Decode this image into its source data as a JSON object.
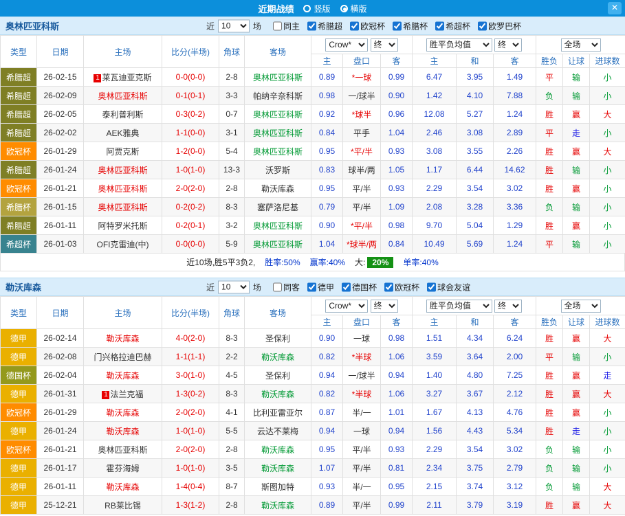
{
  "topbar": {
    "title": "近期战绩",
    "radio_vertical": "竖版",
    "radio_horizontal": "横版",
    "close": "✕"
  },
  "sections": [
    {
      "team": "奥林匹亚科斯",
      "recent_label": "近",
      "recent_count": "10",
      "games_label": "场",
      "checkboxes": [
        {
          "label": "同主",
          "checked": false
        },
        {
          "label": "希腊超",
          "checked": true
        },
        {
          "label": "欧冠杯",
          "checked": true
        },
        {
          "label": "希腊杯",
          "checked": true
        },
        {
          "label": "希超杯",
          "checked": true
        },
        {
          "label": "欧罗巴杯",
          "checked": true
        }
      ],
      "dropdowns": {
        "odds_company": "Crow*",
        "odds_time": "终",
        "europe": "胜平负均值",
        "europe_time": "终",
        "scope": "全场"
      },
      "columns": [
        "类型",
        "日期",
        "主场",
        "比分(半场)",
        "角球",
        "客场",
        "主",
        "盘口",
        "客",
        "主",
        "和",
        "客",
        "胜负",
        "让球",
        "进球数"
      ],
      "rows": [
        {
          "type": "希腊超",
          "type_color": "#7f7f25",
          "date": "26-02-15",
          "home": "莱瓦迪亚克斯",
          "home_badge": "1",
          "home_color": "",
          "score": "0-0(0-0)",
          "corner": "2-8",
          "away": "奥林匹亚科斯",
          "away_color": "green",
          "ah_home": "0.89",
          "handicap": "*一球",
          "ah_away": "0.99",
          "euro_home": "6.47",
          "euro_draw": "3.95",
          "euro_away": "1.49",
          "result": "平",
          "handicap_result": "输",
          "goals": "小"
        },
        {
          "type": "希腊超",
          "type_color": "#7f7f25",
          "date": "26-02-09",
          "home": "奥林匹亚科斯",
          "home_color": "red",
          "score": "0-1(0-1)",
          "corner": "3-3",
          "away": "帕纳辛奈科斯",
          "away_color": "",
          "ah_home": "0.98",
          "handicap": "一/球半",
          "ah_away": "0.90",
          "euro_home": "1.42",
          "euro_draw": "4.10",
          "euro_away": "7.88",
          "result": "负",
          "handicap_result": "输",
          "goals": "小"
        },
        {
          "type": "希腊超",
          "type_color": "#7f7f25",
          "date": "26-02-05",
          "home": "泰利普利斯",
          "home_color": "",
          "score": "0-3(0-2)",
          "corner": "0-7",
          "away": "奥林匹亚科斯",
          "away_color": "green",
          "ah_home": "0.92",
          "handicap": "*球半",
          "ah_away": "0.96",
          "euro_home": "12.08",
          "euro_draw": "5.27",
          "euro_away": "1.24",
          "result": "胜",
          "handicap_result": "赢",
          "goals": "大"
        },
        {
          "type": "希腊超",
          "type_color": "#7f7f25",
          "date": "26-02-02",
          "home": "AEK雅典",
          "home_color": "",
          "score": "1-1(0-0)",
          "corner": "3-1",
          "away": "奥林匹亚科斯",
          "away_color": "green",
          "ah_home": "0.84",
          "handicap": "平手",
          "ah_away": "1.04",
          "euro_home": "2.46",
          "euro_draw": "3.08",
          "euro_away": "2.89",
          "result": "平",
          "handicap_result": "走",
          "goals": "小"
        },
        {
          "type": "欧冠杯",
          "type_color": "#ff8c00",
          "date": "26-01-29",
          "home": "阿贾克斯",
          "home_color": "",
          "score": "1-2(0-0)",
          "corner": "5-4",
          "away": "奥林匹亚科斯",
          "away_color": "green",
          "ah_home": "0.95",
          "handicap": "*平/半",
          "ah_away": "0.93",
          "euro_home": "3.08",
          "euro_draw": "3.55",
          "euro_away": "2.26",
          "result": "胜",
          "handicap_result": "赢",
          "goals": "大"
        },
        {
          "type": "希腊超",
          "type_color": "#7f7f25",
          "date": "26-01-24",
          "home": "奥林匹亚科斯",
          "home_color": "red",
          "score": "1-0(1-0)",
          "corner": "13-3",
          "away": "沃罗斯",
          "away_color": "",
          "ah_home": "0.83",
          "handicap": "球半/两",
          "ah_away": "1.05",
          "euro_home": "1.17",
          "euro_draw": "6.44",
          "euro_away": "14.62",
          "result": "胜",
          "handicap_result": "输",
          "goals": "小"
        },
        {
          "type": "欧冠杯",
          "type_color": "#ff8c00",
          "date": "26-01-21",
          "home": "奥林匹亚科斯",
          "home_color": "red",
          "score": "2-0(2-0)",
          "corner": "2-8",
          "away": "勒沃库森",
          "away_color": "",
          "ah_home": "0.95",
          "handicap": "平/半",
          "ah_away": "0.93",
          "euro_home": "2.29",
          "euro_draw": "3.54",
          "euro_away": "3.02",
          "result": "胜",
          "handicap_result": "赢",
          "goals": "小"
        },
        {
          "type": "希腊杯",
          "type_color": "#b3a33f",
          "date": "26-01-15",
          "home": "奥林匹亚科斯",
          "home_color": "red",
          "score": "0-2(0-2)",
          "corner": "8-3",
          "away": "塞萨洛尼基",
          "away_color": "",
          "ah_home": "0.79",
          "handicap": "平/半",
          "ah_away": "1.09",
          "euro_home": "2.08",
          "euro_draw": "3.28",
          "euro_away": "3.36",
          "result": "负",
          "handicap_result": "输",
          "goals": "小"
        },
        {
          "type": "希腊超",
          "type_color": "#7f7f25",
          "date": "26-01-11",
          "home": "阿特罗米托斯",
          "home_color": "",
          "score": "0-2(0-1)",
          "corner": "3-2",
          "away": "奥林匹亚科斯",
          "away_color": "green",
          "ah_home": "0.90",
          "handicap": "*平/半",
          "ah_away": "0.98",
          "euro_home": "9.70",
          "euro_draw": "5.04",
          "euro_away": "1.29",
          "result": "胜",
          "handicap_result": "赢",
          "goals": "小"
        },
        {
          "type": "希超杯",
          "type_color": "#38838f",
          "date": "26-01-03",
          "home": "OFI克雷迪(中)",
          "home_color": "",
          "score": "0-0(0-0)",
          "corner": "5-9",
          "away": "奥林匹亚科斯",
          "away_color": "green",
          "ah_home": "1.04",
          "handicap": "*球半/两",
          "ah_away": "0.84",
          "euro_home": "10.49",
          "euro_draw": "5.69",
          "euro_away": "1.24",
          "result": "平",
          "handicap_result": "输",
          "goals": "小"
        }
      ],
      "summary": {
        "record": "近10场,胜5平3负2,",
        "win_rate": "胜率:50%",
        "profit_rate": "赢率:40%",
        "big_label": "大:",
        "big_rate": "20%",
        "single_rate": "单率:40%"
      }
    },
    {
      "team": "勒沃库森",
      "recent_label": "近",
      "recent_count": "10",
      "games_label": "场",
      "checkboxes": [
        {
          "label": "同客",
          "checked": false
        },
        {
          "label": "德甲",
          "checked": true
        },
        {
          "label": "德国杯",
          "checked": true
        },
        {
          "label": "欧冠杯",
          "checked": true
        },
        {
          "label": "球会友谊",
          "checked": true
        }
      ],
      "dropdowns": {
        "odds_company": "Crow*",
        "odds_time": "终",
        "europe": "胜平负均值",
        "europe_time": "终",
        "scope": "全场"
      },
      "columns": [
        "类型",
        "日期",
        "主场",
        "比分(半场)",
        "角球",
        "客场",
        "主",
        "盘口",
        "客",
        "主",
        "和",
        "客",
        "胜负",
        "让球",
        "进球数"
      ],
      "rows": [
        {
          "type": "德甲",
          "type_color": "#eab000",
          "date": "26-02-14",
          "home": "勒沃库森",
          "home_color": "red",
          "score": "4-0(2-0)",
          "corner": "8-3",
          "away": "圣保利",
          "away_color": "",
          "ah_home": "0.90",
          "handicap": "一球",
          "ah_away": "0.98",
          "euro_home": "1.51",
          "euro_draw": "4.34",
          "euro_away": "6.24",
          "result": "胜",
          "handicap_result": "赢",
          "goals": "大"
        },
        {
          "type": "德甲",
          "type_color": "#eab000",
          "date": "26-02-08",
          "home": "门兴格拉迪巴赫",
          "home_color": "",
          "score": "1-1(1-1)",
          "corner": "2-2",
          "away": "勒沃库森",
          "away_color": "green",
          "ah_home": "0.82",
          "handicap": "*半球",
          "ah_away": "1.06",
          "euro_home": "3.59",
          "euro_draw": "3.64",
          "euro_away": "2.00",
          "result": "平",
          "handicap_result": "输",
          "goals": "小"
        },
        {
          "type": "德国杯",
          "type_color": "#94991c",
          "date": "26-02-04",
          "home": "勒沃库森",
          "home_color": "red",
          "score": "3-0(1-0)",
          "corner": "4-5",
          "away": "圣保利",
          "away_color": "",
          "ah_home": "0.94",
          "handicap": "一/球半",
          "ah_away": "0.94",
          "euro_home": "1.40",
          "euro_draw": "4.80",
          "euro_away": "7.25",
          "result": "胜",
          "handicap_result": "赢",
          "goals": "走"
        },
        {
          "type": "德甲",
          "type_color": "#eab000",
          "date": "26-01-31",
          "home": "法兰克福",
          "home_badge": "1",
          "home_color": "",
          "score": "1-3(0-2)",
          "corner": "8-3",
          "away": "勒沃库森",
          "away_color": "green",
          "ah_home": "0.82",
          "handicap": "*半球",
          "ah_away": "1.06",
          "euro_home": "3.27",
          "euro_draw": "3.67",
          "euro_away": "2.12",
          "result": "胜",
          "handicap_result": "赢",
          "goals": "大"
        },
        {
          "type": "欧冠杯",
          "type_color": "#ff8c00",
          "date": "26-01-29",
          "home": "勒沃库森",
          "home_color": "red",
          "score": "2-0(2-0)",
          "corner": "4-1",
          "away": "比利亚雷亚尔",
          "away_color": "",
          "ah_home": "0.87",
          "handicap": "半/一",
          "ah_away": "1.01",
          "euro_home": "1.67",
          "euro_draw": "4.13",
          "euro_away": "4.76",
          "result": "胜",
          "handicap_result": "赢",
          "goals": "小"
        },
        {
          "type": "德甲",
          "type_color": "#eab000",
          "date": "26-01-24",
          "home": "勒沃库森",
          "home_color": "red",
          "score": "1-0(1-0)",
          "corner": "5-5",
          "away": "云达不莱梅",
          "away_color": "",
          "ah_home": "0.94",
          "handicap": "一球",
          "ah_away": "0.94",
          "euro_home": "1.56",
          "euro_draw": "4.43",
          "euro_away": "5.34",
          "result": "胜",
          "handicap_result": "走",
          "goals": "小"
        },
        {
          "type": "欧冠杯",
          "type_color": "#ff8c00",
          "date": "26-01-21",
          "home": "奥林匹亚科斯",
          "home_color": "",
          "score": "2-0(2-0)",
          "corner": "2-8",
          "away": "勒沃库森",
          "away_color": "green",
          "ah_home": "0.95",
          "handicap": "平/半",
          "ah_away": "0.93",
          "euro_home": "2.29",
          "euro_draw": "3.54",
          "euro_away": "3.02",
          "result": "负",
          "handicap_result": "输",
          "goals": "小"
        },
        {
          "type": "德甲",
          "type_color": "#eab000",
          "date": "26-01-17",
          "home": "霍芬海姆",
          "home_color": "",
          "score": "1-0(1-0)",
          "corner": "3-5",
          "away": "勒沃库森",
          "away_color": "green",
          "ah_home": "1.07",
          "handicap": "平/半",
          "ah_away": "0.81",
          "euro_home": "2.34",
          "euro_draw": "3.75",
          "euro_away": "2.79",
          "result": "负",
          "handicap_result": "输",
          "goals": "小"
        },
        {
          "type": "德甲",
          "type_color": "#eab000",
          "date": "26-01-11",
          "home": "勒沃库森",
          "home_color": "red",
          "score": "1-4(0-4)",
          "corner": "8-7",
          "away": "斯图加特",
          "away_color": "",
          "ah_home": "0.93",
          "handicap": "半/一",
          "ah_away": "0.95",
          "euro_home": "2.15",
          "euro_draw": "3.74",
          "euro_away": "3.12",
          "result": "负",
          "handicap_result": "输",
          "goals": "大"
        },
        {
          "type": "德甲",
          "type_color": "#eab000",
          "date": "25-12-21",
          "home": "RB莱比锡",
          "home_color": "",
          "score": "1-3(1-2)",
          "corner": "2-8",
          "away": "勒沃库森",
          "away_color": "green",
          "ah_home": "0.89",
          "handicap": "平/半",
          "ah_away": "0.99",
          "euro_home": "2.11",
          "euro_draw": "3.79",
          "euro_away": "3.19",
          "result": "胜",
          "handicap_result": "赢",
          "goals": "大"
        }
      ],
      "summary": null
    }
  ]
}
